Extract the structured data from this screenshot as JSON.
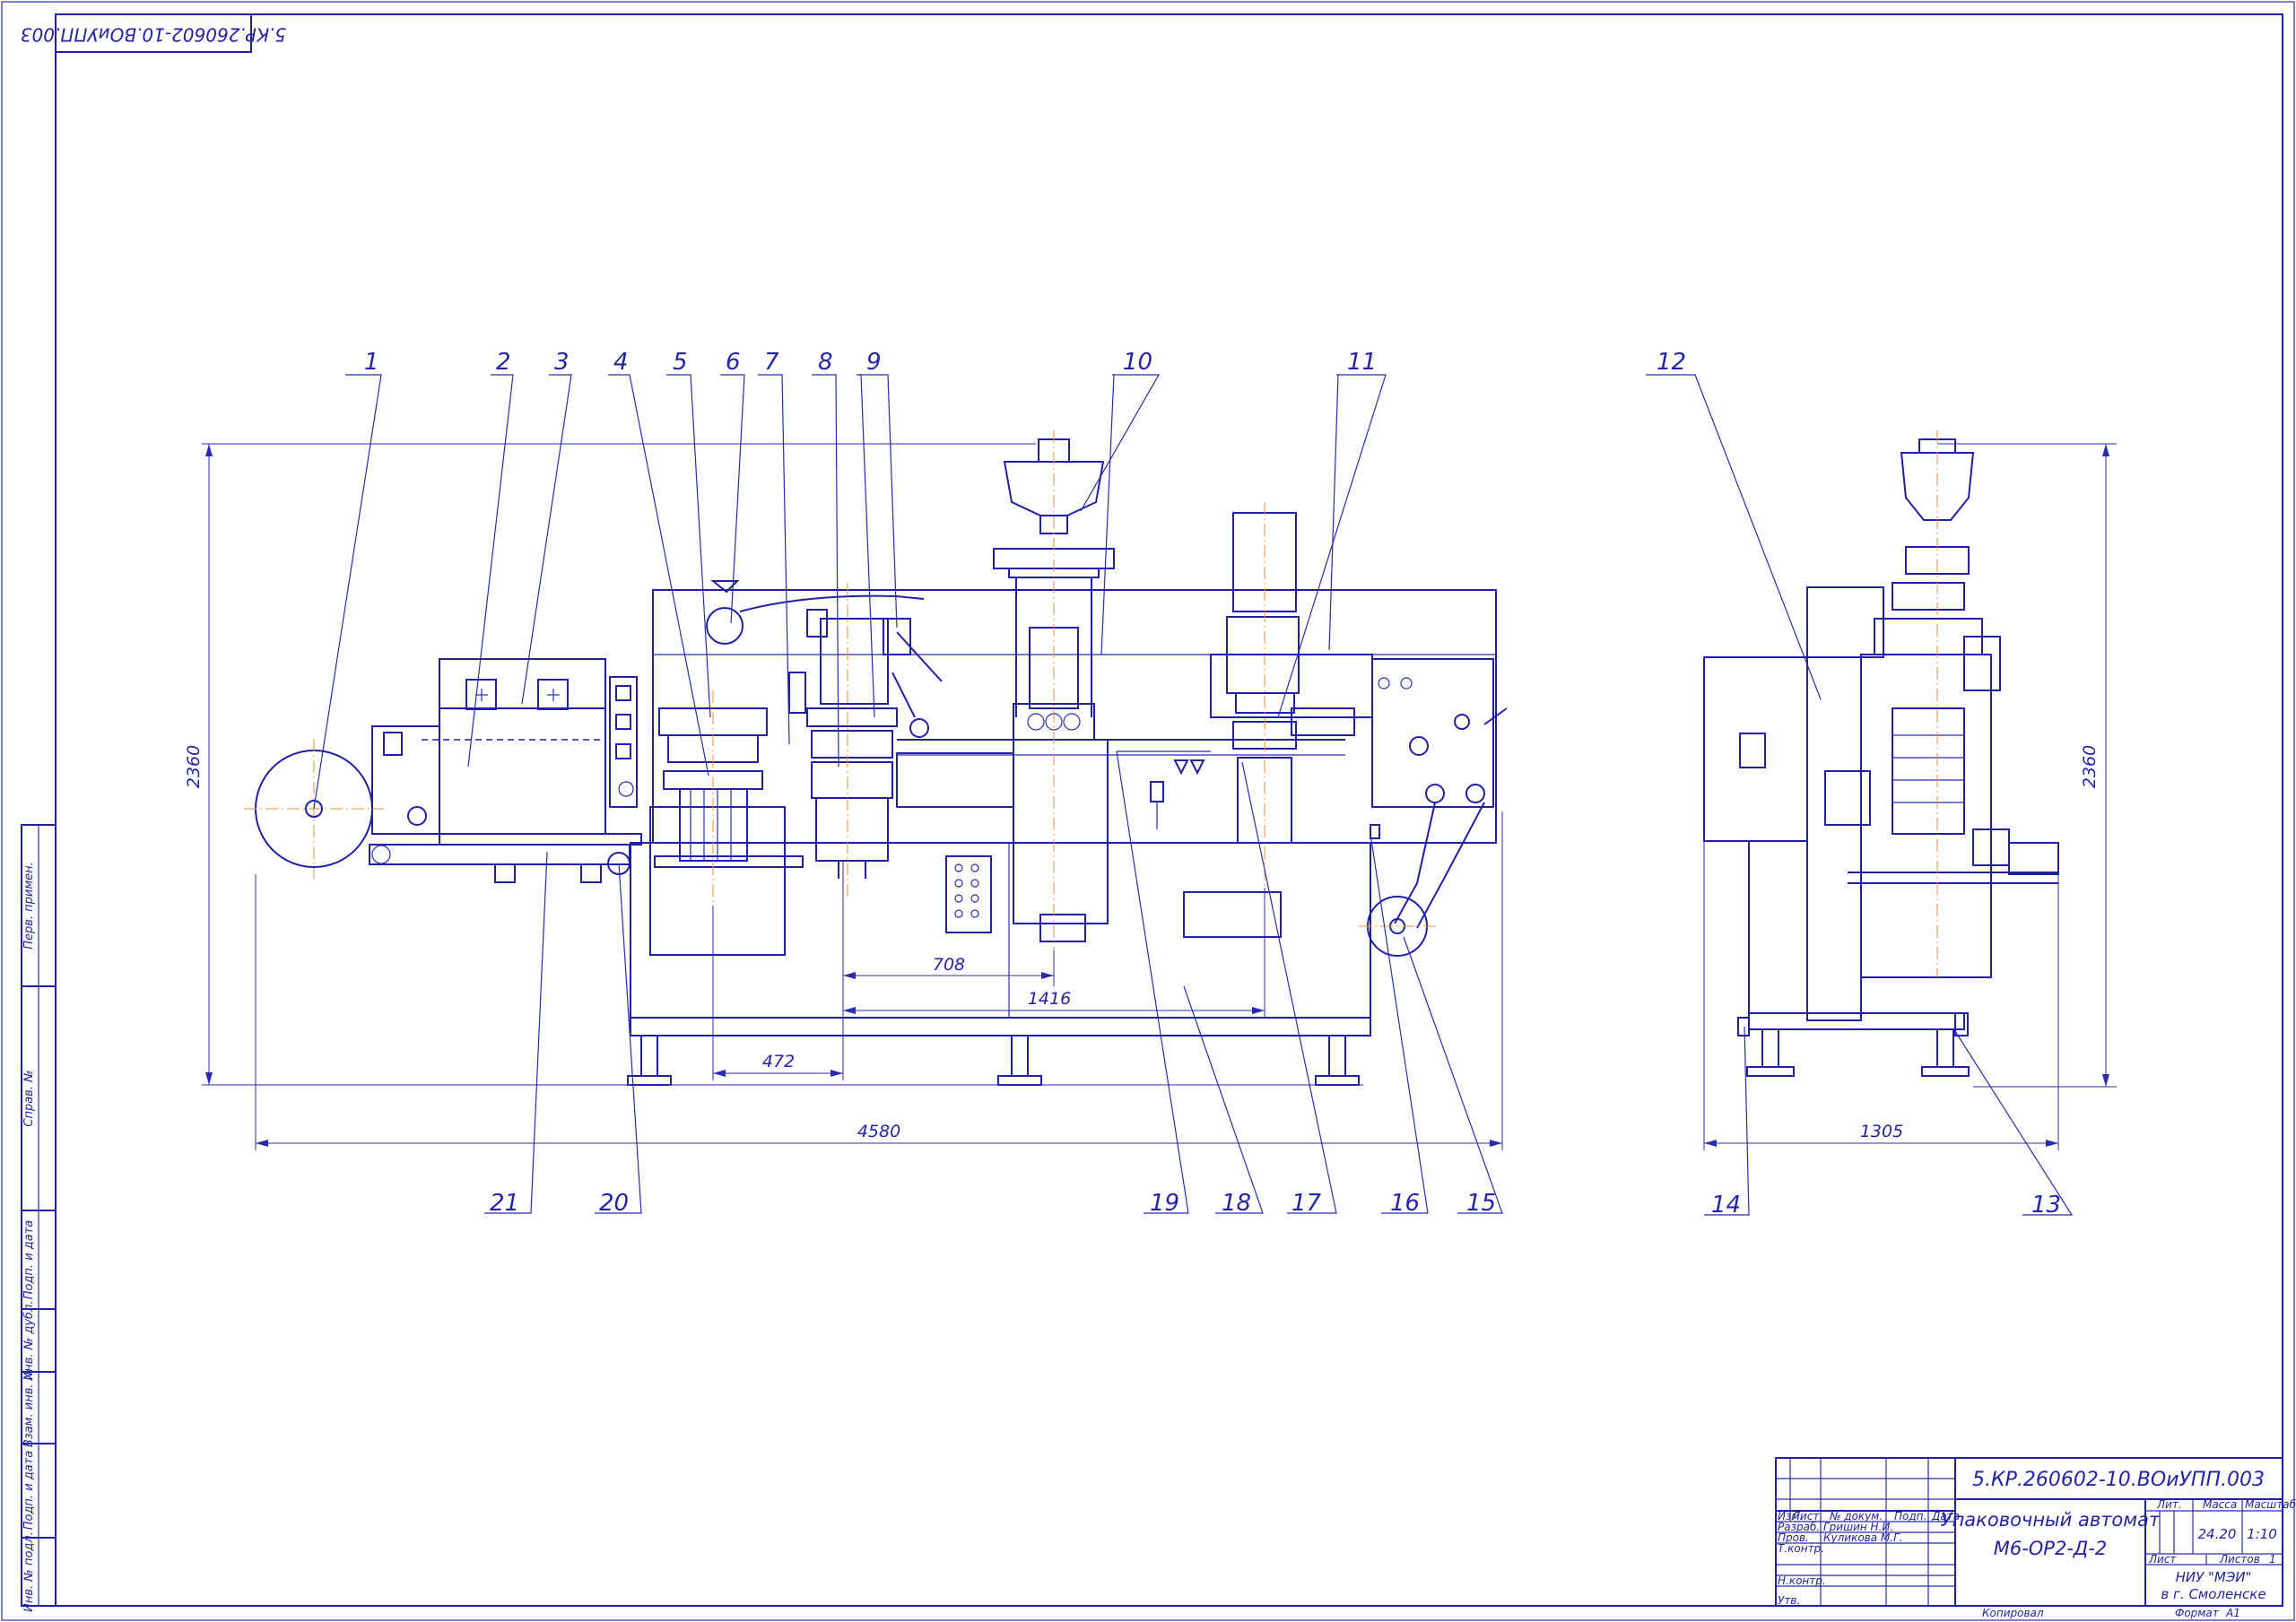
{
  "drawing_code_stamp": "5.КР.260602-10.ВОиУПП.003",
  "callouts": [
    "1",
    "2",
    "3",
    "4",
    "5",
    "6",
    "7",
    "8",
    "9",
    "10",
    "11",
    "12",
    "13",
    "14",
    "15",
    "16",
    "17",
    "18",
    "19",
    "20",
    "21"
  ],
  "dimensions": {
    "height_front": "2360",
    "height_side": "2360",
    "overall_length": "4580",
    "side_width": "1305",
    "dim_708": "708",
    "dim_1416": "1416",
    "dim_472": "472"
  },
  "side_strip": {
    "perv_primen": "Перв. примен.",
    "sprav_no": "Справ. №",
    "podp_data_1": "Подп. и дата",
    "inv_dubl": "Инв. № дубл.",
    "vzam_inv": "Взам. инв. №",
    "podp_data_2": "Подп. и дата",
    "inv_podl": "Инв. № подл."
  },
  "title_block": {
    "designation": "5.КР.260602-10.ВОиУПП.003",
    "name_line1": "Упаковочный автомат",
    "name_line2": "М6-ОР2-Д-2",
    "col_izm": "Изм.",
    "col_list": "Лист",
    "col_ndok": "№ докум.",
    "col_podp": "Подп.",
    "col_data": "Дата",
    "razrab": "Разраб.",
    "razrab_name": "Гришин Н.И.",
    "prov": "Пров.",
    "prov_name": "Куликова М.Г.",
    "tkontr": "Т.контр.",
    "nkontr": "Н.контр.",
    "utv": "Утв.",
    "lit": "Лит.",
    "massa": "Масса",
    "masshtab": "Масштаб",
    "massa_value": "24.20",
    "masshtab_value": "1:10",
    "sheet_label": "Лист",
    "sheets_label": "Листов",
    "sheets_value": "1",
    "org_line1": "НИУ \"МЭИ\"",
    "org_line2": "в г. Смоленске",
    "kopiroval": "Копировал",
    "format": "Формат",
    "format_value": "А1"
  }
}
